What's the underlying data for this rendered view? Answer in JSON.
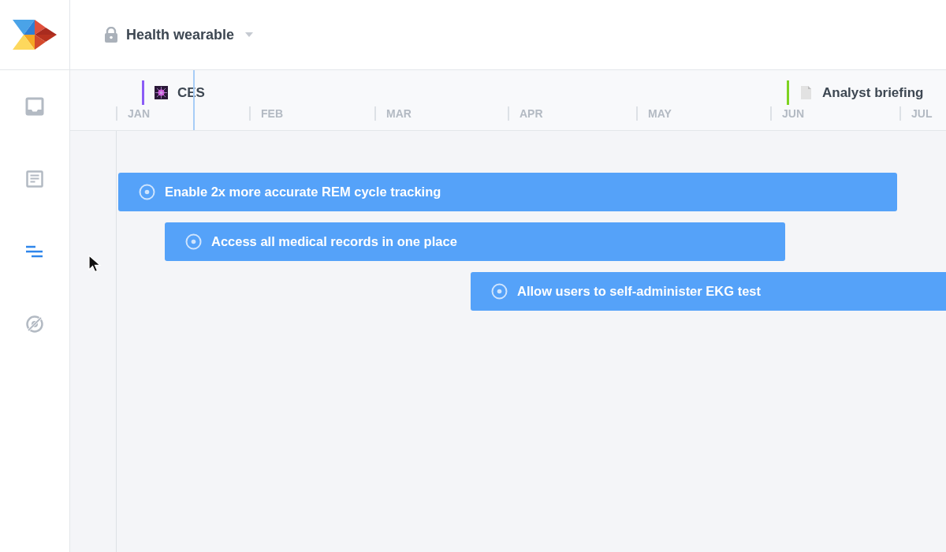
{
  "header": {
    "project": "Health wearable",
    "locked": true
  },
  "sidebar": {
    "items": [
      {
        "kind": "inbox",
        "selected": false
      },
      {
        "kind": "document",
        "selected": false
      },
      {
        "kind": "roadmap",
        "selected": true
      },
      {
        "kind": "hidden",
        "selected": false
      }
    ]
  },
  "timeline": {
    "months": [
      "JAN",
      "FEB",
      "MAR",
      "APR",
      "MAY",
      "JUN",
      "JUL"
    ],
    "milestones": [
      {
        "kind": "event",
        "label": "CES",
        "color": "#8b5cf6"
      },
      {
        "kind": "document",
        "label": "Analyst briefing",
        "color": "#7ed321"
      }
    ],
    "goals": [
      {
        "label": "Enable 2x more accurate REM cycle tracking"
      },
      {
        "label": "Access all medical records in one place"
      },
      {
        "label": "Allow users to self-administer EKG test"
      }
    ]
  }
}
